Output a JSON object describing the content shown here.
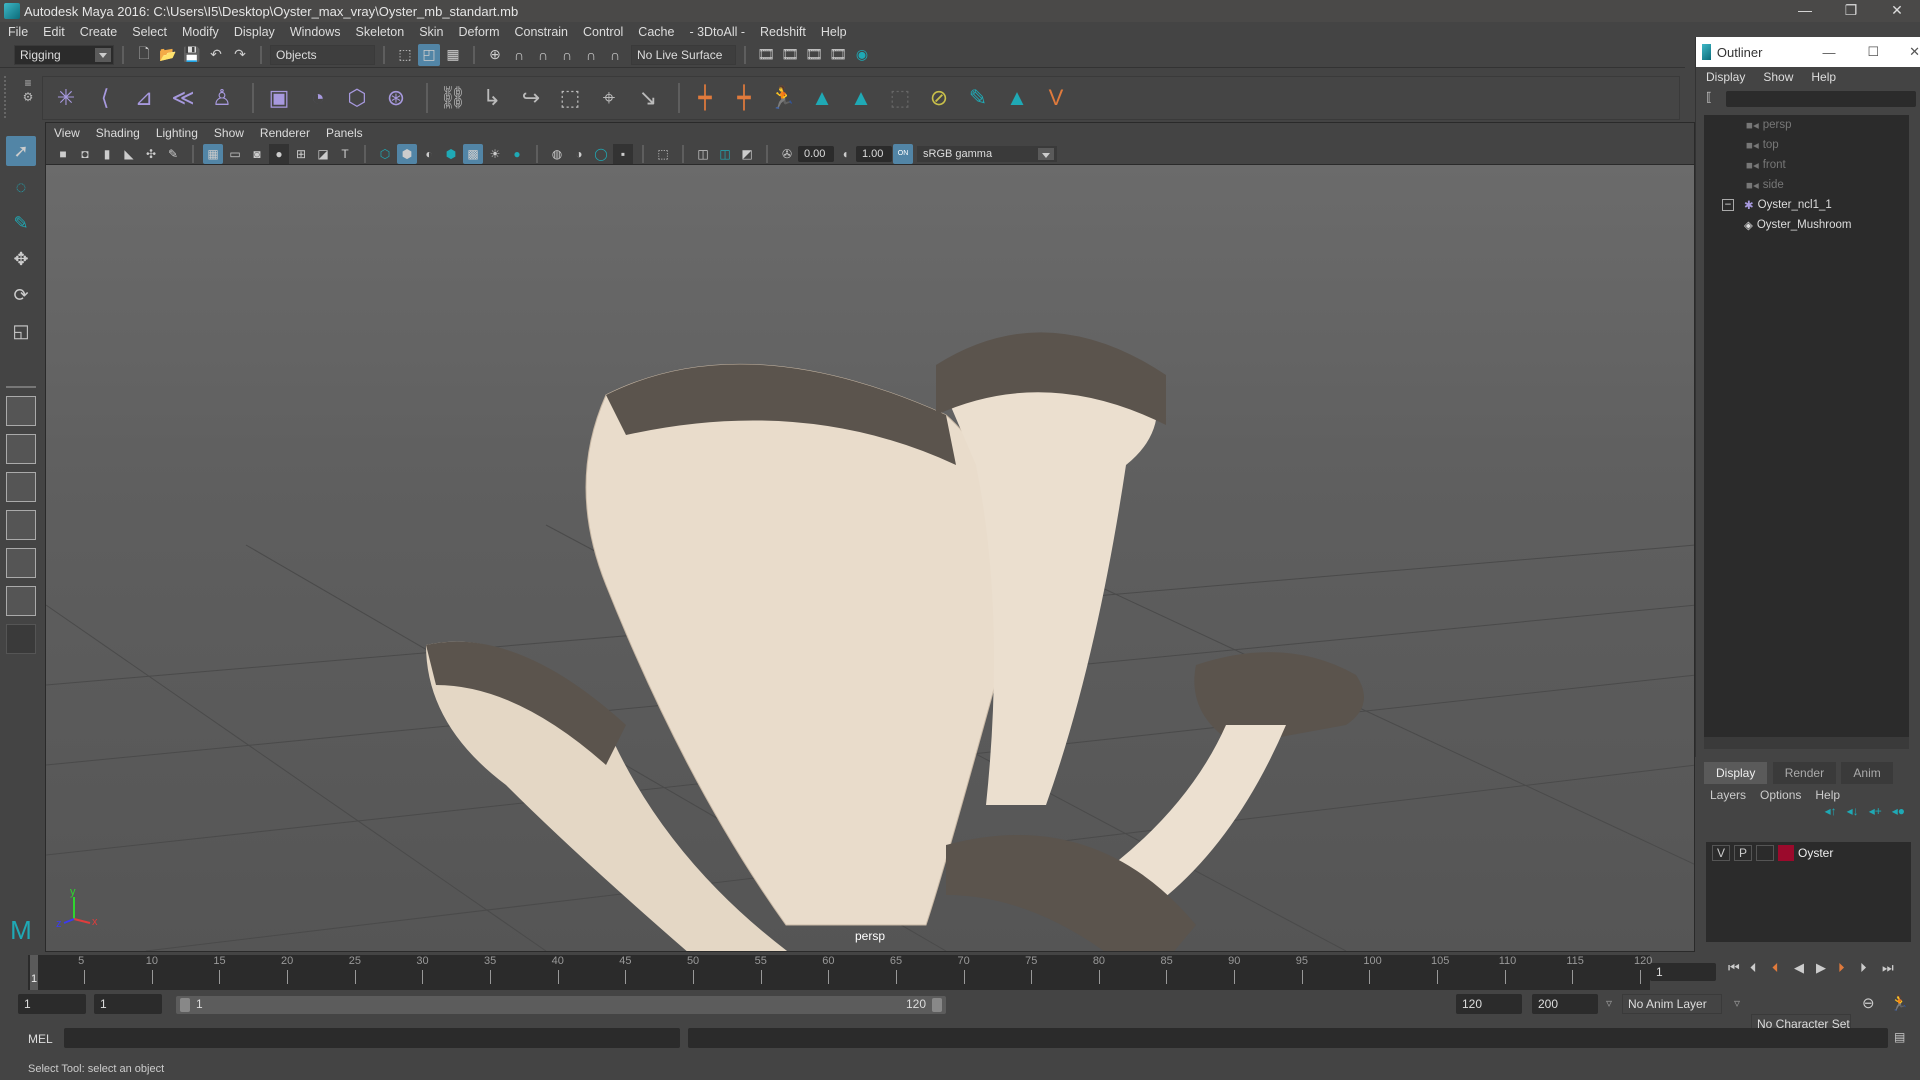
{
  "window": {
    "title": "Autodesk Maya 2016: C:\\Users\\I5\\Desktop\\Oyster_max_vray\\Oyster_mb_standart.mb",
    "minimize": "—",
    "restore": "❐",
    "close": "✕"
  },
  "menubar": [
    "File",
    "Edit",
    "Create",
    "Select",
    "Modify",
    "Display",
    "Windows",
    "Skeleton",
    "Skin",
    "Deform",
    "Constrain",
    "Control",
    "Cache",
    "- 3DtoAll -",
    "Redshift",
    "Help"
  ],
  "statusline": {
    "menuset": "Rigging",
    "selection_mode": "Objects",
    "live_surface": "No Live Surface"
  },
  "shelf": {
    "side_icons": [
      "≡",
      "⚙"
    ]
  },
  "panel": {
    "menu": [
      "View",
      "Shading",
      "Lighting",
      "Show",
      "Renderer",
      "Panels"
    ],
    "exposure": "0.00",
    "gamma": "1.00",
    "color_mgmt_toggle": "ON",
    "color_space": "sRGB gamma",
    "camera": "persp"
  },
  "axis": {
    "x": "x",
    "y": "y",
    "z": "z"
  },
  "outliner": {
    "title": "Outliner",
    "menu": [
      "Display",
      "Show",
      "Help"
    ],
    "items": [
      {
        "label": "persp",
        "type": "camera",
        "dim": true
      },
      {
        "label": "top",
        "type": "camera",
        "dim": true
      },
      {
        "label": "front",
        "type": "camera",
        "dim": true
      },
      {
        "label": "side",
        "type": "camera",
        "dim": true
      },
      {
        "label": "Oyster_ncl1_1",
        "type": "group",
        "dim": false
      },
      {
        "label": "Oyster_Mushroom",
        "type": "mesh",
        "dim": false
      }
    ]
  },
  "layer_editor": {
    "tabs": [
      "Display",
      "Render",
      "Anim"
    ],
    "active_tab": "Display",
    "menu": [
      "Layers",
      "Options",
      "Help"
    ],
    "layers": [
      {
        "visible": "V",
        "playback": "P",
        "name": "Oyster",
        "color": "#9b0a2c"
      }
    ]
  },
  "timeline": {
    "ticks": [
      1,
      5,
      10,
      15,
      20,
      25,
      30,
      35,
      40,
      45,
      50,
      55,
      60,
      65,
      70,
      75,
      80,
      85,
      90,
      95,
      100,
      105,
      110,
      115,
      120
    ],
    "current_frame": "1"
  },
  "range": {
    "start": "1",
    "playback_start": "1",
    "slider_start": "1",
    "slider_end": "120",
    "playback_end": "120",
    "end": "200",
    "anim_layer": "No Anim Layer",
    "character_set": "No Character Set"
  },
  "cmdline": {
    "language": "MEL"
  },
  "helpline": "Select Tool: select an object"
}
